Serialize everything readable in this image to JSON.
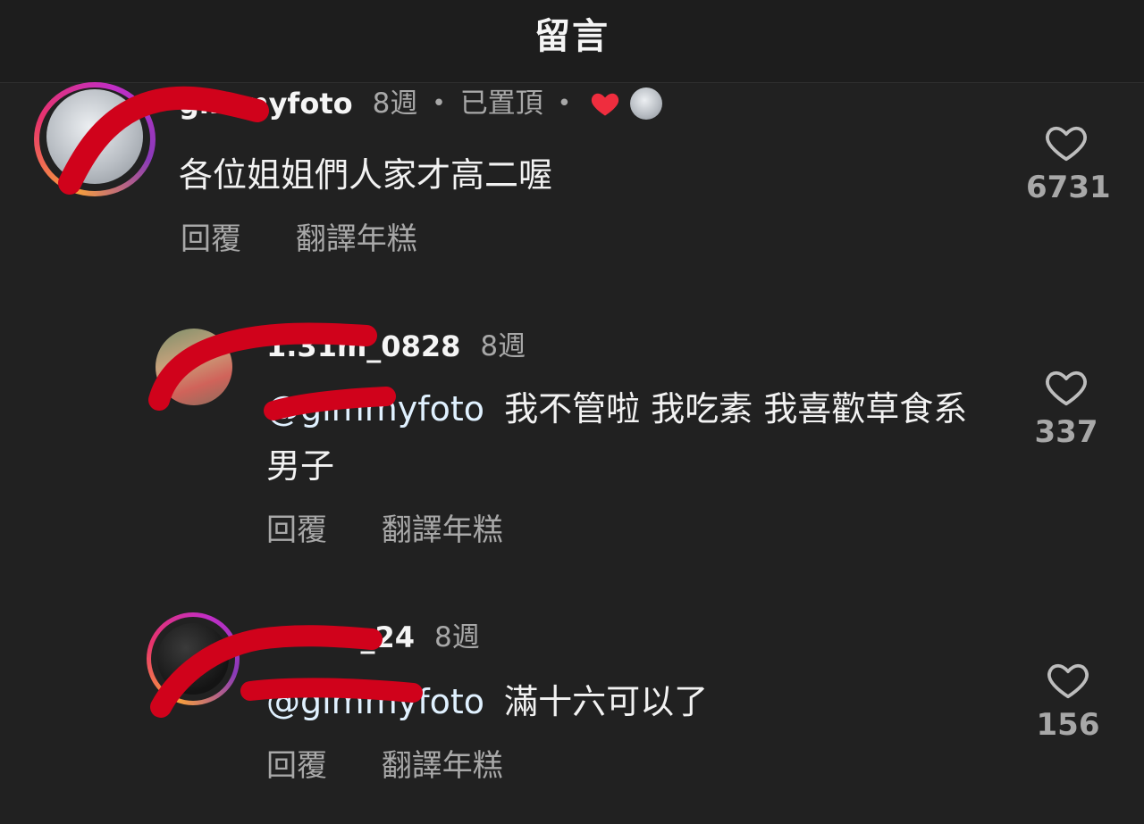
{
  "header": {
    "title": "留言"
  },
  "comments": [
    {
      "username": "gimmyfoto",
      "time": "8週",
      "pinned": "已置頂",
      "text": "各位姐姐們人家才高二喔",
      "reply_label": "回覆",
      "translate_label": "翻譯年糕",
      "likes": "6731"
    },
    {
      "username": "1.31m_0828",
      "time": "8週",
      "mention": "@gimmyfoto",
      "text": "我不管啦 我吃素 我喜歡草食系男子",
      "reply_label": "回覆",
      "translate_label": "翻譯年糕",
      "likes": "337"
    },
    {
      "username": "_24",
      "time": "8週",
      "mention": "@gimmyfoto",
      "text": "滿十六可以了",
      "reply_label": "回覆",
      "translate_label": "翻譯年糕",
      "likes": "156"
    }
  ],
  "icons": {
    "like": "heart-outline-icon",
    "creator_like": "heart-filled-icon"
  },
  "colors": {
    "background": "#212121",
    "accent_red": "#ef2d3e",
    "redaction": "#d0021b",
    "muted": "#a8a8a8"
  }
}
